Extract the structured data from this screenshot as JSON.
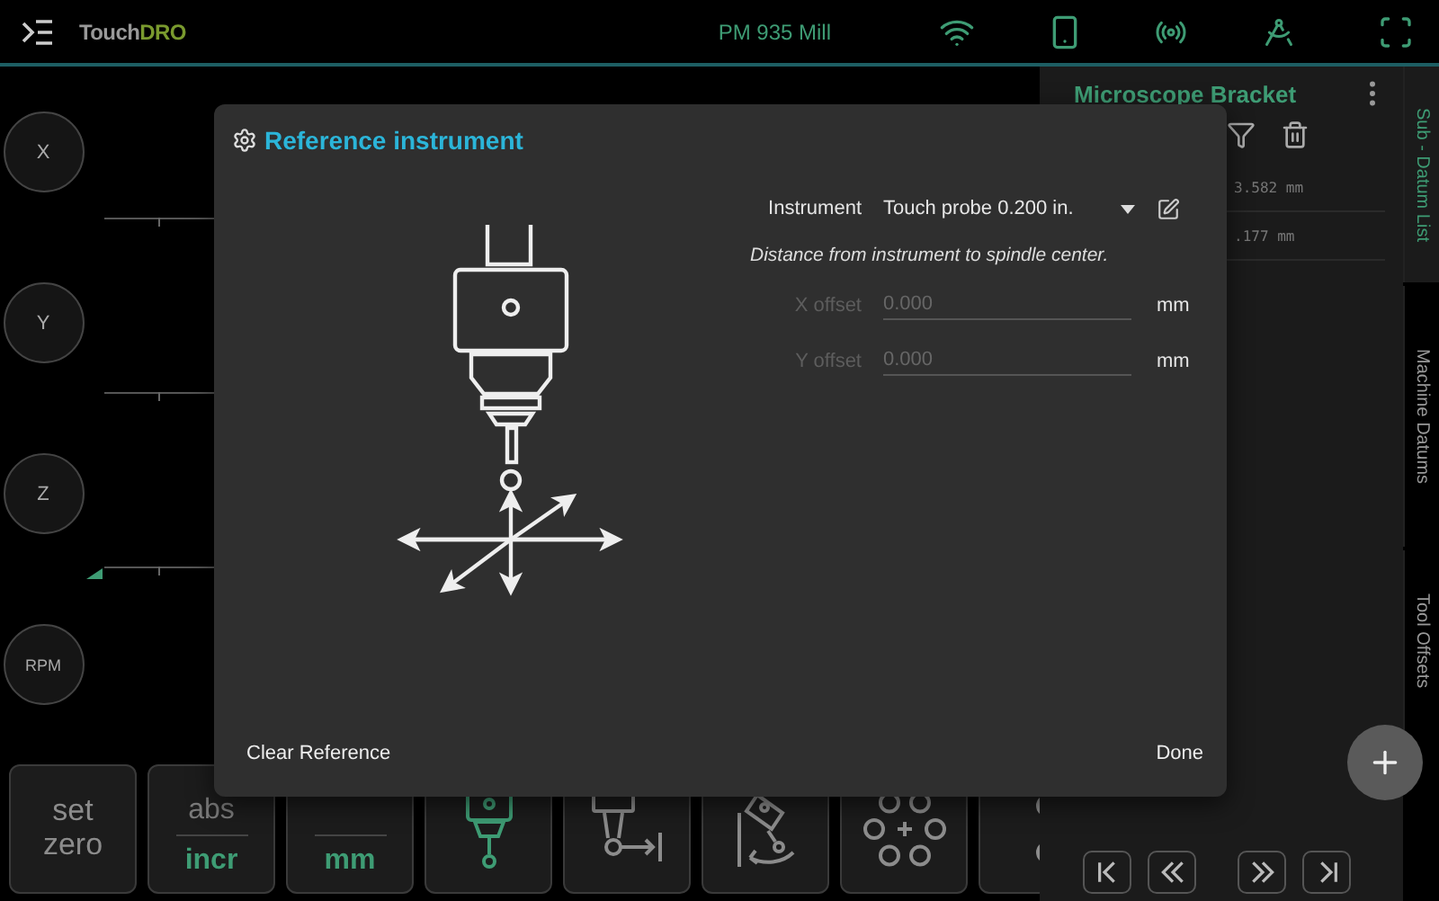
{
  "top_bar": {
    "logo_parts": [
      "Touch",
      "DRO"
    ],
    "machine": "PM 935 Mill"
  },
  "axes": [
    {
      "label": "X"
    },
    {
      "label": "Y"
    },
    {
      "label": "Z"
    },
    {
      "label": "RPM"
    }
  ],
  "side_panel": {
    "title": "Microscope Bracket",
    "rows": [
      {
        "value": "3.582 mm"
      },
      {
        "value": ".177 mm"
      }
    ]
  },
  "side_tabs": [
    {
      "label": "Sub - Datum List",
      "selected": true
    },
    {
      "label": "Machine Datums",
      "selected": false
    },
    {
      "label": "Tool Offsets",
      "selected": false
    }
  ],
  "toolbar": [
    {
      "kind": "text",
      "label": "set zero"
    },
    {
      "kind": "toggle",
      "options": [
        {
          "label": "abs",
          "selected": false
        },
        {
          "label": "incr",
          "selected": true
        }
      ]
    },
    {
      "kind": "toggle",
      "options": [
        {
          "label": "mm",
          "selected": true
        }
      ]
    },
    {
      "kind": "probe"
    },
    {
      "kind": "edge"
    },
    {
      "kind": "rotate"
    },
    {
      "kind": "bolt"
    },
    {
      "kind": "pair"
    }
  ],
  "nav": [
    {
      "kind": "first"
    },
    {
      "kind": "back"
    },
    {
      "kind": "forward"
    },
    {
      "kind": "last"
    }
  ],
  "dialog": {
    "title": "Reference instrument",
    "instrument_label": "Instrument",
    "instrument_value": "Touch probe 0.200 in.",
    "hint": "Distance from instrument to spindle center.",
    "offsets": [
      {
        "label": "X offset",
        "placeholder": "0.000",
        "unit": "mm",
        "disabled": true
      },
      {
        "label": "Y offset",
        "placeholder": "0.000",
        "unit": "mm",
        "disabled": true
      }
    ],
    "buttons": [
      {
        "label": "Clear Reference"
      },
      {
        "label": "Done"
      }
    ]
  }
}
